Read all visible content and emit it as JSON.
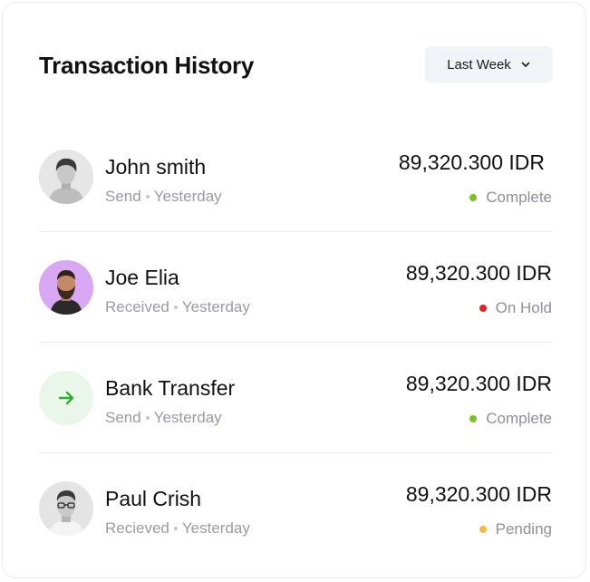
{
  "header": {
    "title": "Transaction History",
    "filter_label": "Last Week"
  },
  "transactions": [
    {
      "name": "John smith",
      "type": "Send",
      "time": "Yesterday",
      "amount": "89,320.300 IDR",
      "status": "Complete",
      "status_color": "#7cc121",
      "avatar": "person-photo-icon"
    },
    {
      "name": "Joe Elia",
      "type": "Received",
      "time": "Yesterday",
      "amount": "89,320.300 IDR",
      "status": "On Hold",
      "status_color": "#e02424",
      "avatar": "person-photo-icon",
      "avatar_bg": "#d8a8f5"
    },
    {
      "name": "Bank Transfer",
      "type": "Send",
      "time": "Yesterday",
      "amount": "89,320.300 IDR",
      "status": "Complete",
      "status_color": "#7cc121",
      "avatar": "arrow-right-icon",
      "avatar_bg": "#eaf6ea",
      "icon_color": "#2fae2f"
    },
    {
      "name": "Paul Crish",
      "type": "Recieved",
      "time": "Yesterday",
      "amount": "89,320.300 IDR",
      "status": "Pending",
      "status_color": "#f5b942",
      "avatar": "person-photo-icon"
    }
  ]
}
